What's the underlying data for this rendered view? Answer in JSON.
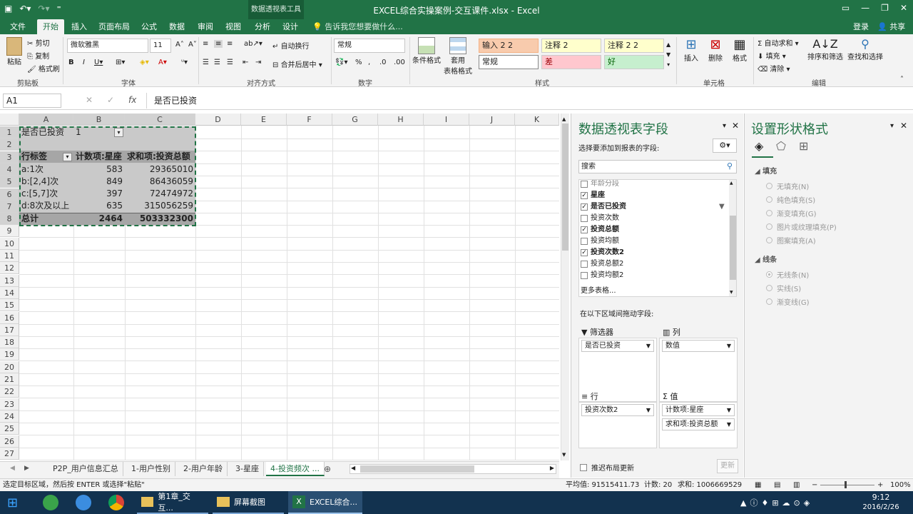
{
  "title_bar": {
    "context_tool": "数据透视表工具",
    "title": "EXCEL综合实操案例-交互课件.xlsx - Excel"
  },
  "tabs": [
    "文件",
    "开始",
    "插入",
    "页面布局",
    "公式",
    "数据",
    "审阅",
    "视图",
    "分析",
    "设计"
  ],
  "tell_me": "告诉我您想要做什么...",
  "account": {
    "signin": "登录",
    "share": "共享"
  },
  "ribbon": {
    "clipboard": {
      "paste": "粘贴",
      "cut": "剪切",
      "copy": "复制",
      "painter": "格式刷",
      "label": "剪贴板"
    },
    "font": {
      "name": "微软雅黑",
      "size": "11",
      "label": "字体"
    },
    "align": {
      "wrap": "自动换行",
      "merge": "合并后居中",
      "label": "对齐方式"
    },
    "number": {
      "format": "常规",
      "label": "数字"
    },
    "styles": {
      "cond": "条件格式",
      "table1": "套用",
      "table2": "表格格式",
      "label": "样式",
      "cells": [
        "输入 2 2",
        "注释 2",
        "注释 2 2",
        "常规",
        "差",
        "好"
      ]
    },
    "cells": {
      "insert": "插入",
      "delete": "删除",
      "format": "格式",
      "label": "单元格"
    },
    "edit": {
      "autosum": "自动求和",
      "fill": "填充",
      "clear": "清除",
      "sort": "排序和筛选",
      "find": "查找和选择",
      "label": "编辑"
    }
  },
  "formula_bar": {
    "namebox": "A1",
    "fx": "fx",
    "value": "是否已投资"
  },
  "columns": [
    "A",
    "B",
    "C",
    "D",
    "E",
    "F",
    "G",
    "H",
    "I",
    "J",
    "K"
  ],
  "rows": [
    "1",
    "2",
    "3",
    "4",
    "5",
    "6",
    "7",
    "8",
    "9",
    "10",
    "11",
    "12",
    "13",
    "14",
    "15",
    "16",
    "17",
    "18",
    "19",
    "20",
    "21",
    "22",
    "23",
    "24",
    "25",
    "26",
    "27"
  ],
  "pivot": {
    "filter_label": "是否已投资",
    "filter_value": "1",
    "header": [
      "行标签",
      "计数项:星座",
      "求和项:投资总额"
    ],
    "data": [
      [
        "a:1次",
        "583",
        "29365010"
      ],
      [
        "b:[2,4]次",
        "849",
        "86436059"
      ],
      [
        "c:[5,7]次",
        "397",
        "72474972"
      ],
      [
        "d:8次及以上",
        "635",
        "315056259"
      ]
    ],
    "total": [
      "总计",
      "2464",
      "503332300"
    ]
  },
  "pivot_panel": {
    "title": "数据透视表字段",
    "subtitle": "选择要添加到报表的字段:",
    "search": "搜索",
    "fields": [
      {
        "name": "年龄分段",
        "checked": false,
        "bold": false
      },
      {
        "name": "星座",
        "checked": true,
        "bold": true
      },
      {
        "name": "是否已投资",
        "checked": true,
        "bold": true
      },
      {
        "name": "投资次数",
        "checked": false,
        "bold": false
      },
      {
        "name": "投资总额",
        "checked": true,
        "bold": true
      },
      {
        "name": "投资均额",
        "checked": false,
        "bold": false
      },
      {
        "name": "投资次数2",
        "checked": true,
        "bold": true
      },
      {
        "name": "投资总额2",
        "checked": false,
        "bold": false
      },
      {
        "name": "投资均额2",
        "checked": false,
        "bold": false
      }
    ],
    "more": "更多表格...",
    "drag_hint": "在以下区域间拖动字段:",
    "areas": {
      "filter": {
        "label": "筛选器",
        "items": [
          "是否已投资"
        ]
      },
      "columns": {
        "label": "列",
        "items": [
          "数值"
        ]
      },
      "rows": {
        "label": "行",
        "items": [
          "投资次数2"
        ]
      },
      "values": {
        "label": "值",
        "items": [
          "计数项:星座",
          "求和项:投资总额"
        ]
      }
    },
    "defer": "推迟布局更新",
    "update": "更新"
  },
  "format_panel": {
    "title": "设置形状格式",
    "fill_label": "填充",
    "fill_options": [
      "无填充(N)",
      "纯色填充(S)",
      "渐变填充(G)",
      "图片或纹理填充(P)",
      "图案填充(A)"
    ],
    "line_label": "线条",
    "line_options": [
      "无线条(N)",
      "实线(S)",
      "渐变线(G)"
    ]
  },
  "sheets": [
    "P2P_用户信息汇总",
    "1-用户性别",
    "2-用户年龄",
    "3-星座",
    "4-投资频次 ..."
  ],
  "status": {
    "message": "选定目标区域，然后按 ENTER 或选择\"粘贴\"",
    "average": "平均值: 91515411.73",
    "count": "计数: 20",
    "sum": "求和: 1006669529",
    "zoom": "100%"
  },
  "taskbar": {
    "items": [
      "第1章_交互...",
      "屏幕截图",
      "EXCEL综合..."
    ],
    "time": "9:12",
    "date": "2016/2/26"
  },
  "colors": {
    "brand": "#217346",
    "pivot_fill": "#c9c9c9",
    "pivot_header": "#a6a6a6"
  }
}
